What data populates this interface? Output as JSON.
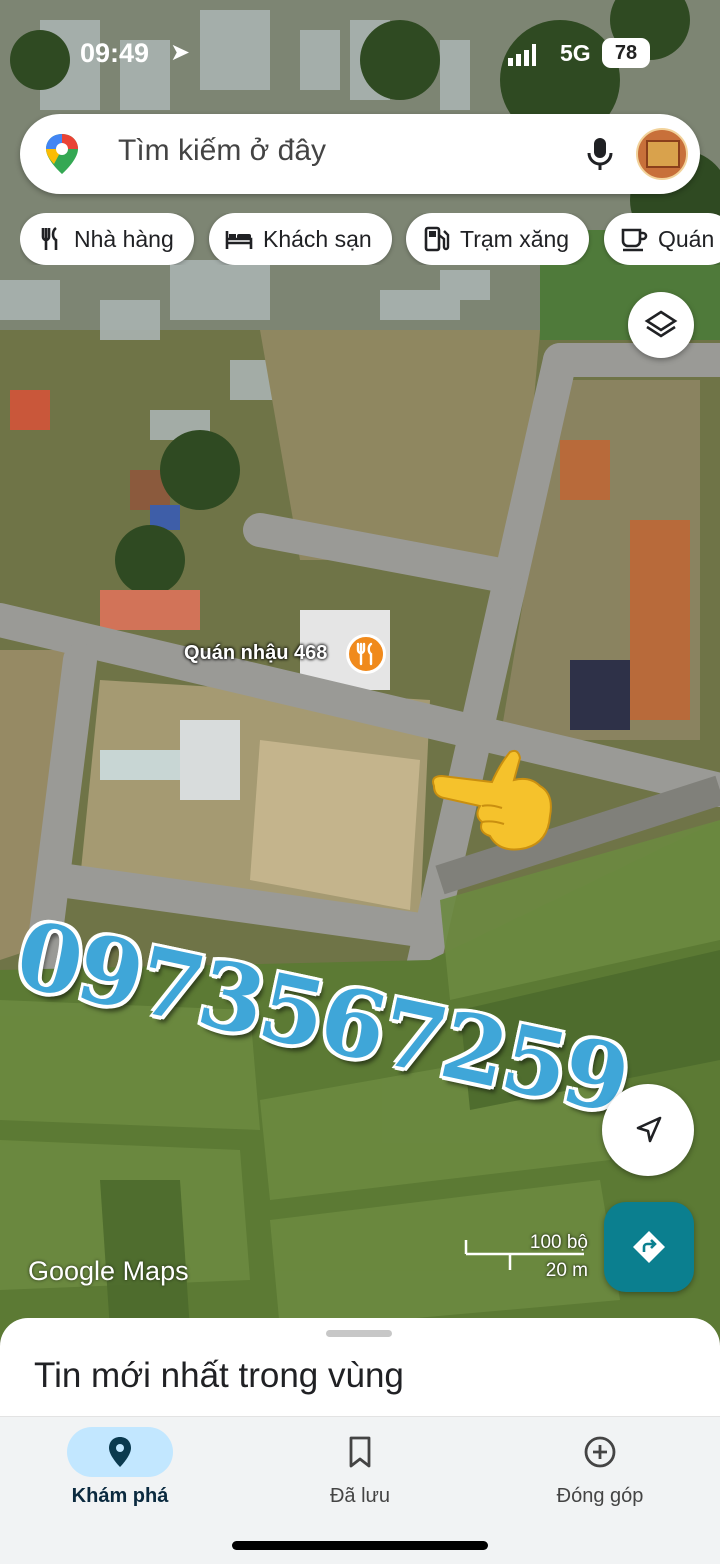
{
  "status_bar": {
    "time": "09:49",
    "network": "5G",
    "battery": "78"
  },
  "search": {
    "placeholder": "Tìm kiếm ở đây"
  },
  "chips": [
    {
      "label": "Nhà hàng",
      "icon": "restaurant-icon"
    },
    {
      "label": "Khách sạn",
      "icon": "bed-icon"
    },
    {
      "label": "Trạm xăng",
      "icon": "gas-station-icon"
    },
    {
      "label": "Quán",
      "icon": "cafe-icon"
    }
  ],
  "map": {
    "poi_label": "Quán nhậu 468",
    "overlay_phone": "0973567259",
    "logo": "Google Maps",
    "scale_imperial": "100 bộ",
    "scale_metric": "20 m"
  },
  "sheet": {
    "title": "Tin mới nhất trong vùng"
  },
  "nav": [
    {
      "label": "Khám phá",
      "icon": "explore-pin-icon",
      "active": true
    },
    {
      "label": "Đã lưu",
      "icon": "bookmark-icon",
      "active": false
    },
    {
      "label": "Đóng góp",
      "icon": "add-circle-icon",
      "active": false
    }
  ],
  "colors": {
    "accent": "#0b7f8f",
    "poi": "#f08a1c",
    "phone_text": "#3fa6d8",
    "nav_active": "#c2e7ff"
  }
}
